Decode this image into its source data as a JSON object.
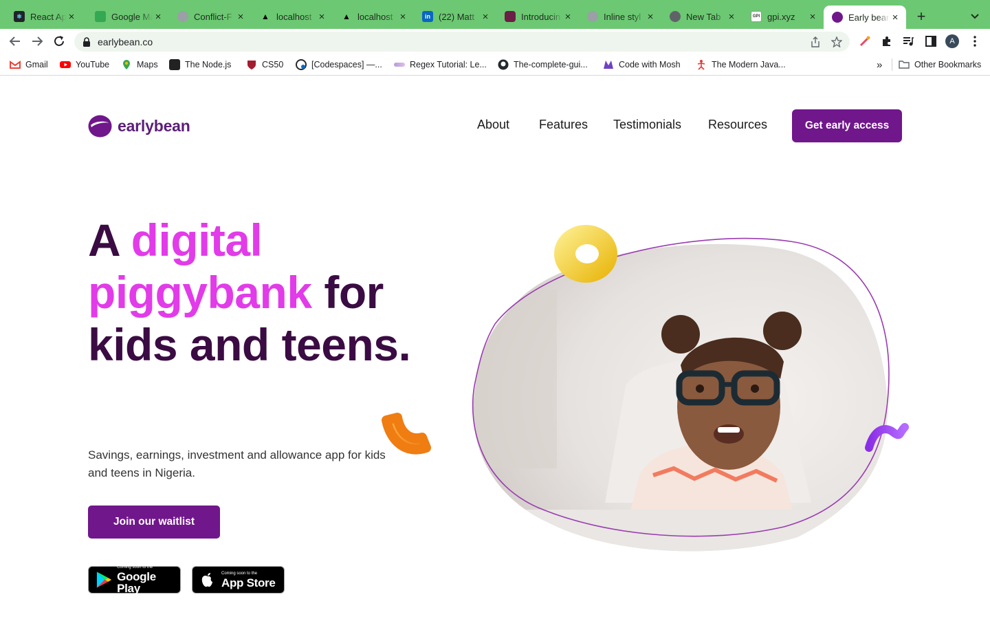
{
  "browser": {
    "tabs": [
      {
        "label": "React App",
        "fav_color": "#20232a"
      },
      {
        "label": "Google Maps",
        "fav_color": "#34a853"
      },
      {
        "label": "Conflict-F",
        "fav_color": "#888888"
      },
      {
        "label": "localhost",
        "fav_color": "#000000"
      },
      {
        "label": "localhost",
        "fav_color": "#000000"
      },
      {
        "label": "(22) Matt",
        "fav_color": "#0a66c2"
      },
      {
        "label": "Introducin",
        "fav_color": "#c2185b"
      },
      {
        "label": "Inline styl",
        "fav_color": "#888888"
      },
      {
        "label": "New Tab",
        "fav_color": "#5f6368"
      },
      {
        "label": "gpi.xyz",
        "fav_color": "#555555"
      },
      {
        "label": "Early bean",
        "fav_color": "#70178b"
      }
    ],
    "address": "earlybean.co",
    "profile_initial": "A",
    "bookmarks": [
      {
        "label": "Gmail",
        "color": "#ea4335"
      },
      {
        "label": "YouTube",
        "color": "#ff0000"
      },
      {
        "label": "Maps",
        "color": "#34a853"
      },
      {
        "label": "The Node.js",
        "color": "#222222"
      },
      {
        "label": "CS50",
        "color": "#a51c30"
      },
      {
        "label": "[Codespaces] —...",
        "color": "#0b6bcb"
      },
      {
        "label": "Regex Tutorial: Le...",
        "color": "#b39ddb"
      },
      {
        "label": "The-complete-gui...",
        "color": "#24292f"
      },
      {
        "label": "Code with Mosh",
        "color": "#6f42c1"
      },
      {
        "label": "The Modern Java...",
        "color": "#e53935"
      }
    ],
    "bookmarks_overflow": "»",
    "other_bookmarks": "Other Bookmarks"
  },
  "site": {
    "brand": "earlybean",
    "nav": [
      "About",
      "Features",
      "Testimonials",
      "Resources"
    ],
    "cta": "Get early access",
    "headline": {
      "part1": "A ",
      "highlight1": "digital",
      "highlight2": "piggybank",
      "part2": " for kids and teens."
    },
    "subtitle": "Savings, earnings, investment and allowance app for kids and teens in Nigeria.",
    "waitlist": "Join our waitlist",
    "google_play": {
      "small": "Coming soon to the",
      "big": "Google Play"
    },
    "app_store": {
      "small": "Coming soon to the",
      "big": "App Store"
    }
  },
  "colors": {
    "brand_purple": "#70178b",
    "headline_dark": "#3b0b43",
    "headline_pink": "#e23be9",
    "tabbar_green": "#6cc872"
  }
}
